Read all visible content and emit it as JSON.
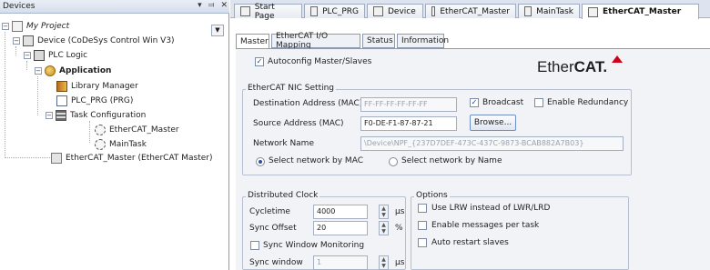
{
  "left_pane": {
    "title": "Devices",
    "header_icons": [
      "▾",
      "⫤",
      "✕"
    ],
    "tree": [
      {
        "label": "My Project",
        "style": "italic",
        "icon": "project-icon",
        "toggle": "−"
      },
      {
        "label": "Device (CoDeSys Control Win V3)",
        "icon": "device-icon",
        "toggle": "−"
      },
      {
        "label": "PLC Logic",
        "icon": "plc-logic-icon",
        "toggle": "−"
      },
      {
        "label": "Application",
        "style": "bold",
        "icon": "application-icon",
        "toggle": "−"
      },
      {
        "label": "Library Manager",
        "icon": "library-manager-icon"
      },
      {
        "label": "PLC_PRG (PRG)",
        "icon": "program-icon"
      },
      {
        "label": "Task Configuration",
        "icon": "task-configuration-icon",
        "toggle": "−"
      },
      {
        "label": "EtherCAT_Master",
        "icon": "gear-icon"
      },
      {
        "label": "MainTask",
        "icon": "gear-icon"
      },
      {
        "label": "EtherCAT_Master (EtherCAT Master)",
        "icon": "ethercat-master-icon"
      }
    ]
  },
  "editor_tabs": [
    {
      "label": "Start Page"
    },
    {
      "label": "PLC_PRG"
    },
    {
      "label": "Device"
    },
    {
      "label": "EtherCAT_Master"
    },
    {
      "label": "MainTask"
    },
    {
      "label": "EtherCAT_Master",
      "active": true
    }
  ],
  "sub_tabs": [
    {
      "label": "Master",
      "active": true
    },
    {
      "label": "EtherCAT I/O Mapping"
    },
    {
      "label": "Status"
    },
    {
      "label": "Information"
    }
  ],
  "master": {
    "autoconfig_label": "Autoconfig Master/Slaves",
    "autoconfig_checked": true,
    "logo_text_light": "Ether",
    "logo_text_bold": "CAT.",
    "nic_group_title": "EtherCAT NIC Setting",
    "dest_label": "Destination Address (MAC)",
    "dest_value": "FF-FF-FF-FF-FF-FF",
    "broadcast_label": "Broadcast",
    "broadcast_checked": true,
    "redundancy_label": "Enable Redundancy",
    "redundancy_checked": false,
    "source_label": "Source Address (MAC)",
    "source_value": "F0-DE-F1-87-87-21",
    "browse_label": "Browse...",
    "network_name_label": "Network Name",
    "network_name_value": "\\Device\\NPF_{237D7DEF-473C-437C-9873-BCAB882A7B03}",
    "select_mac_label": "Select network by MAC",
    "select_name_label": "Select network by Name",
    "dc_group_title": "Distributed Clock",
    "cycletime_label": "Cycletime",
    "cycletime_value": "4000",
    "cycletime_unit": "µs",
    "sync_offset_label": "Sync Offset",
    "sync_offset_value": "20",
    "sync_offset_unit": "%",
    "sync_window_monitoring_label": "Sync Window Monitoring",
    "sync_window_label": "Sync window",
    "sync_window_value": "1",
    "sync_window_unit": "µs",
    "options_group_title": "Options",
    "use_lrw_label": "Use LRW instead of LWR/LRD",
    "enable_messages_label": "Enable messages per task",
    "auto_restart_label": "Auto restart slaves"
  },
  "colors": {
    "accent": "#2a4f9c",
    "logo_red": "#d0011b"
  }
}
